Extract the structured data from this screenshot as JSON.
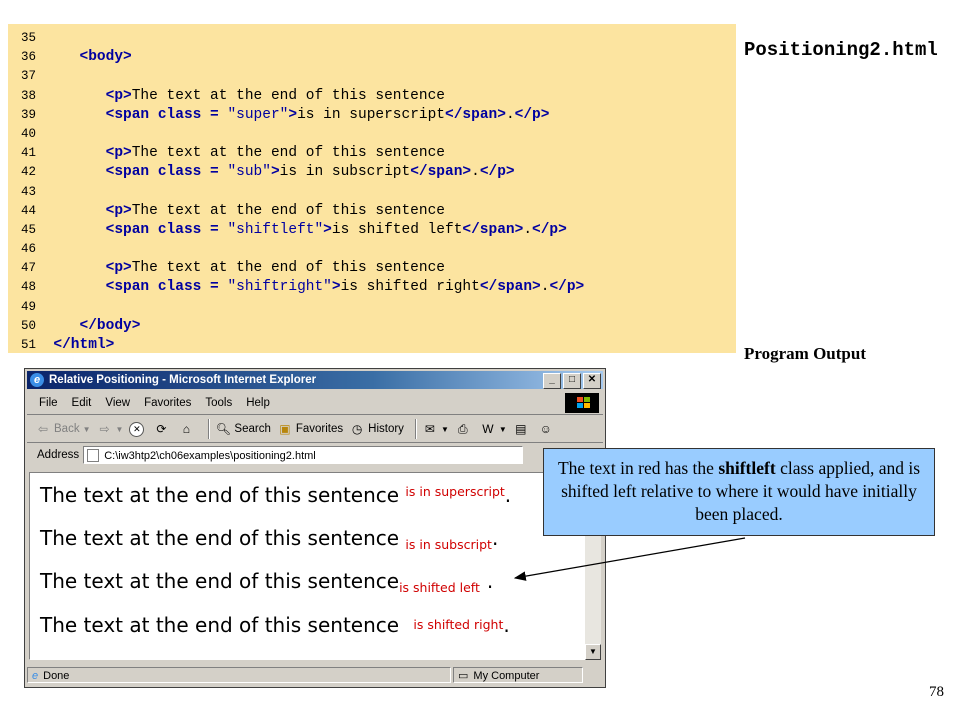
{
  "code": {
    "lines": [
      {
        "num": "35",
        "parts": []
      },
      {
        "num": "36",
        "parts": [
          {
            "t": "tag",
            "s": "<body>"
          }
        ],
        "indent": "   "
      },
      {
        "num": "37",
        "parts": []
      },
      {
        "num": "38",
        "indent": "      ",
        "parts": [
          {
            "t": "tag",
            "s": "<p>"
          },
          {
            "t": "txt",
            "s": "The text at the end of this sentence"
          }
        ]
      },
      {
        "num": "39",
        "indent": "      ",
        "parts": [
          {
            "t": "tag",
            "s": "<span class = "
          },
          {
            "t": "str",
            "s": "\"super\""
          },
          {
            "t": "tag",
            "s": ">"
          },
          {
            "t": "txt",
            "s": "is in superscript"
          },
          {
            "t": "tag",
            "s": "</span>"
          },
          {
            "t": "txt",
            "s": "."
          },
          {
            "t": "tag",
            "s": "</p>"
          }
        ]
      },
      {
        "num": "40",
        "parts": []
      },
      {
        "num": "41",
        "indent": "      ",
        "parts": [
          {
            "t": "tag",
            "s": "<p>"
          },
          {
            "t": "txt",
            "s": "The text at the end of this sentence"
          }
        ]
      },
      {
        "num": "42",
        "indent": "      ",
        "parts": [
          {
            "t": "tag",
            "s": "<span class = "
          },
          {
            "t": "str",
            "s": "\"sub\""
          },
          {
            "t": "tag",
            "s": ">"
          },
          {
            "t": "txt",
            "s": "is in subscript"
          },
          {
            "t": "tag",
            "s": "</span>"
          },
          {
            "t": "txt",
            "s": "."
          },
          {
            "t": "tag",
            "s": "</p>"
          }
        ]
      },
      {
        "num": "43",
        "parts": []
      },
      {
        "num": "44",
        "indent": "      ",
        "parts": [
          {
            "t": "tag",
            "s": "<p>"
          },
          {
            "t": "txt",
            "s": "The text at the end of this sentence"
          }
        ]
      },
      {
        "num": "45",
        "indent": "      ",
        "parts": [
          {
            "t": "tag",
            "s": "<span class = "
          },
          {
            "t": "str",
            "s": "\"shiftleft\""
          },
          {
            "t": "tag",
            "s": ">"
          },
          {
            "t": "txt",
            "s": "is shifted left"
          },
          {
            "t": "tag",
            "s": "</span>"
          },
          {
            "t": "txt",
            "s": "."
          },
          {
            "t": "tag",
            "s": "</p>"
          }
        ]
      },
      {
        "num": "46",
        "parts": []
      },
      {
        "num": "47",
        "indent": "      ",
        "parts": [
          {
            "t": "tag",
            "s": "<p>"
          },
          {
            "t": "txt",
            "s": "The text at the end of this sentence"
          }
        ]
      },
      {
        "num": "48",
        "indent": "      ",
        "parts": [
          {
            "t": "tag",
            "s": "<span class = "
          },
          {
            "t": "str",
            "s": "\"shiftright\""
          },
          {
            "t": "tag",
            "s": ">"
          },
          {
            "t": "txt",
            "s": "is shifted right"
          },
          {
            "t": "tag",
            "s": "</span>"
          },
          {
            "t": "txt",
            "s": "."
          },
          {
            "t": "tag",
            "s": "</p>"
          }
        ]
      },
      {
        "num": "49",
        "parts": []
      },
      {
        "num": "50",
        "indent": "   ",
        "parts": [
          {
            "t": "tag",
            "s": "</body>"
          }
        ]
      },
      {
        "num": "51",
        "indent": "",
        "parts": [
          {
            "t": "tag",
            "s": "</html>"
          }
        ]
      }
    ]
  },
  "file_title": "Positioning2.html",
  "output_label": "Program Output",
  "page_number": "78",
  "browser": {
    "title": "Relative Positioning - Microsoft Internet Explorer",
    "menu": [
      "File",
      "Edit",
      "View",
      "Favorites",
      "Tools",
      "Help"
    ],
    "toolbar": {
      "back": "Back",
      "search": "Search",
      "favorites": "Favorites",
      "history": "History"
    },
    "address_label": "Address",
    "address_value": "C:\\iw3htp2\\ch06examples\\positioning2.html",
    "sentences": [
      {
        "main": "The text at the end of this sentence",
        "span": "is in superscript",
        "end": "."
      },
      {
        "main": "The text at the end of this sentence",
        "span": "is in subscript",
        "end": "."
      },
      {
        "main": "The text at the end of this sentence",
        "span": "is shifted left",
        "end": "."
      },
      {
        "main": "The text at the end of this sentence",
        "span": "is shifted right",
        "end": "."
      }
    ],
    "status_done": "Done",
    "status_zone": "My Computer"
  },
  "callout": {
    "pre": "The text in red has the ",
    "bold": "shiftleft",
    "post": " class applied, and is shifted left relative to where it would have initially been placed."
  },
  "colors": {
    "code_bg": "#fce4a0",
    "tag": "#0000a0",
    "callout_bg": "#99ccff",
    "red_text": "#d00000"
  }
}
